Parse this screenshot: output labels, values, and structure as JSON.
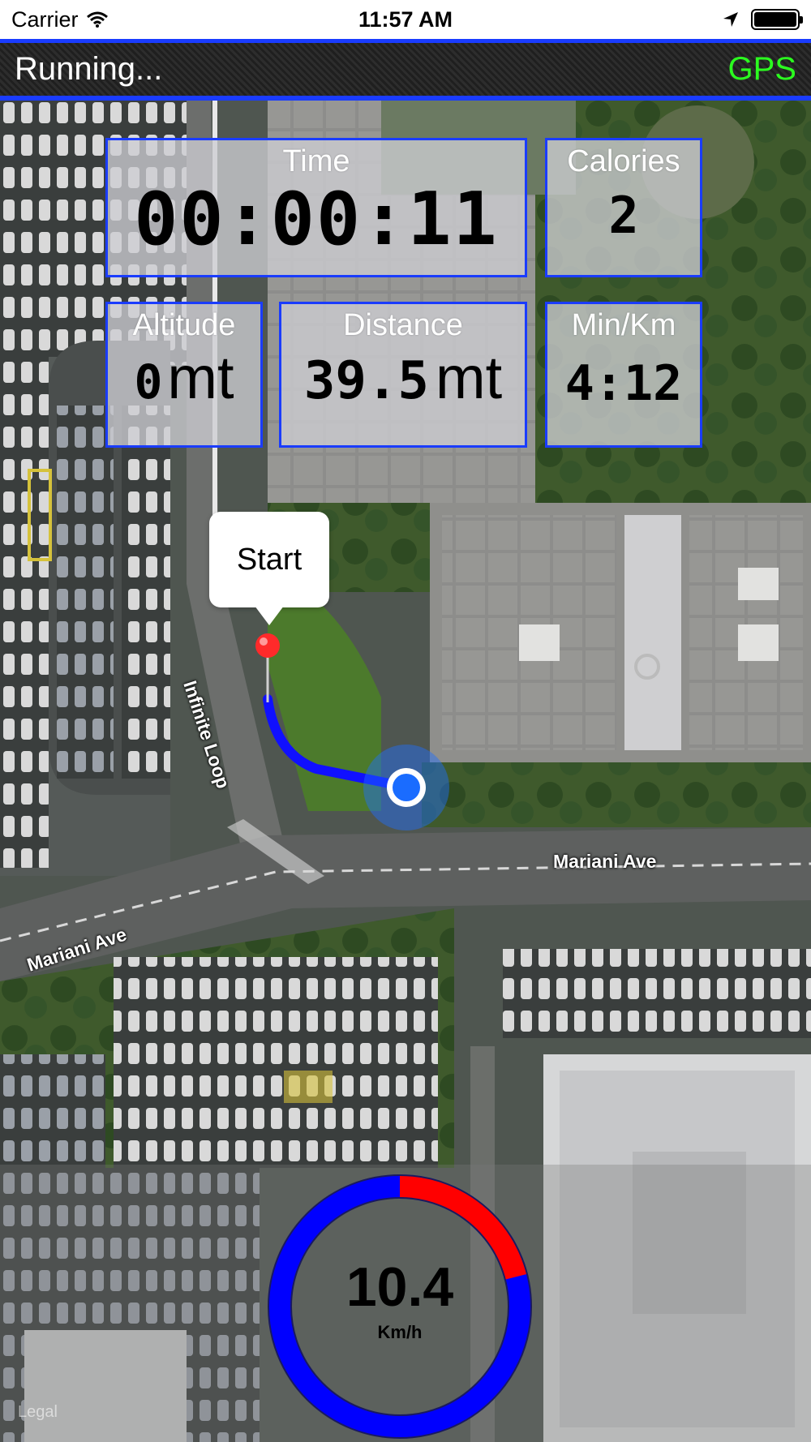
{
  "status_bar": {
    "carrier": "Carrier",
    "time": "11:57 AM",
    "icons": [
      "wifi-icon",
      "location-arrow-icon",
      "battery-icon"
    ]
  },
  "header": {
    "title": "Running...",
    "gps_label": "GPS",
    "gps_color": "#2bff1f",
    "accent_color": "#1a3cff"
  },
  "stats": {
    "time": {
      "label": "Time",
      "value": "00:00:11"
    },
    "calories": {
      "label": "Calories",
      "value": "2"
    },
    "altitude": {
      "label": "Altitude",
      "value": "0",
      "unit": "mt"
    },
    "distance": {
      "label": "Distance",
      "value": "39.5",
      "unit": "mt"
    },
    "pace": {
      "label": "Min/Km",
      "value": "4:12"
    }
  },
  "map": {
    "start_callout": "Start",
    "street_labels": [
      "Infinite Loop",
      "Mariani Ave",
      "Mariani Ave"
    ],
    "legal": "Legal",
    "route_color": "#1010ff",
    "pin_color": "#ff2a2a"
  },
  "speedometer": {
    "value": "10.4",
    "unit": "Km/h",
    "red_fraction": 0.21,
    "colors": {
      "ring": "#0000ff",
      "warning": "#ff0000"
    }
  }
}
